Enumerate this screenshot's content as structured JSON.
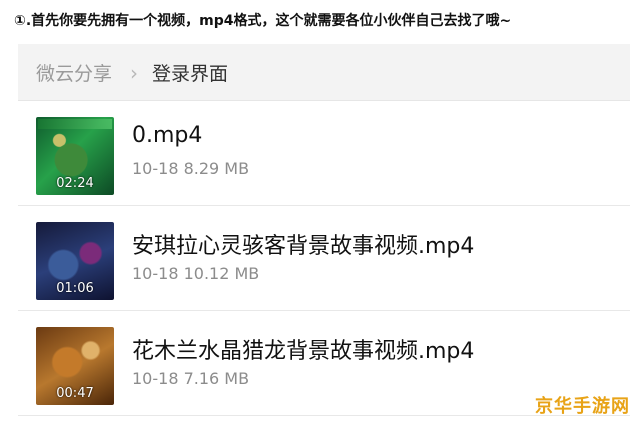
{
  "instruction": "①.首先你要先拥有一个视频，mp4格式，这个就需要各位小伙伴自己去找了哦~",
  "breadcrumb": {
    "root": "微云分享",
    "separator": "›",
    "current": "登录界面"
  },
  "files": [
    {
      "name": "0.mp4",
      "meta": "10-18 8.29 MB",
      "duration": "02:24"
    },
    {
      "name": "安琪拉心灵骇客背景故事视频.mp4",
      "meta": "10-18 10.12 MB",
      "duration": "01:06"
    },
    {
      "name": "花木兰水晶猎龙背景故事视频.mp4",
      "meta": "10-18 7.16 MB",
      "duration": "00:47"
    }
  ],
  "watermark": "京华手游网",
  "colors": {
    "breadcrumb_bg": "#f3f3f3",
    "meta_text": "#8c8c8c",
    "watermark": "#e8a317"
  }
}
